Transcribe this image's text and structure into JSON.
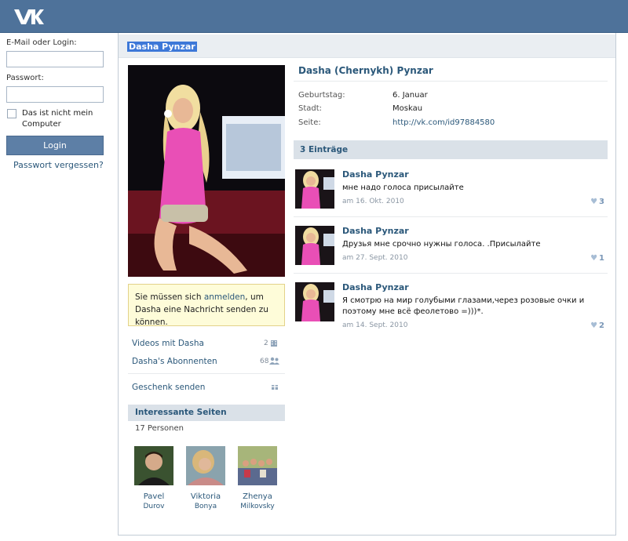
{
  "login": {
    "email_label": "E-Mail oder Login:",
    "password_label": "Passwort:",
    "remember_label": "Das ist nicht mein Computer",
    "login_button": "Login",
    "forgot_link": "Passwort vergessen?"
  },
  "profile": {
    "title": "Dasha Pynzar",
    "full_name": "Dasha (Chernykh) Pynzar",
    "info": [
      {
        "label": "Geburtstag:",
        "value": "6. Januar"
      },
      {
        "label": "Stadt:",
        "value": "Moskau"
      },
      {
        "label": "Seite:",
        "value": "http://vk.com/id97884580"
      }
    ]
  },
  "notice": {
    "before": "Sie müssen sich ",
    "link": "anmelden",
    "after": ", um Dasha eine Nachricht senden zu können."
  },
  "sidebar": {
    "videos_label": "Videos mit Dasha",
    "videos_count": "2",
    "subscribers_label": "Dasha's Abonnenten",
    "subscribers_count": "68",
    "gift_label": "Geschenk senden",
    "interesting_header": "Interessante Seiten",
    "interesting_count": "17 Personen",
    "people": [
      {
        "first": "Pavel",
        "last": "Durov"
      },
      {
        "first": "Viktoria",
        "last": "Bonya"
      },
      {
        "first": "Zhenya",
        "last": "Milkovsky"
      }
    ]
  },
  "wall": {
    "entries_label": "3 Einträge",
    "posts": [
      {
        "author": "Dasha Pynzar",
        "text": "мне надо голоса присылайте",
        "date": "am 16. Okt. 2010",
        "likes": "3"
      },
      {
        "author": "Dasha Pynzar",
        "text": "Друзья мне срочно нужны голоса. .Присылайте",
        "date": "am 27. Sept. 2010",
        "likes": "1"
      },
      {
        "author": "Dasha Pynzar",
        "text": "Я смотрю на мир голубыми глазами,через розовые очки и поэтому мне всё феолетово =)))*.",
        "date": "am 14. Sept. 2010",
        "likes": "2"
      }
    ]
  },
  "colors": {
    "header": "#4e729a",
    "link": "#2b587a",
    "section_bg": "#dae1e8"
  }
}
